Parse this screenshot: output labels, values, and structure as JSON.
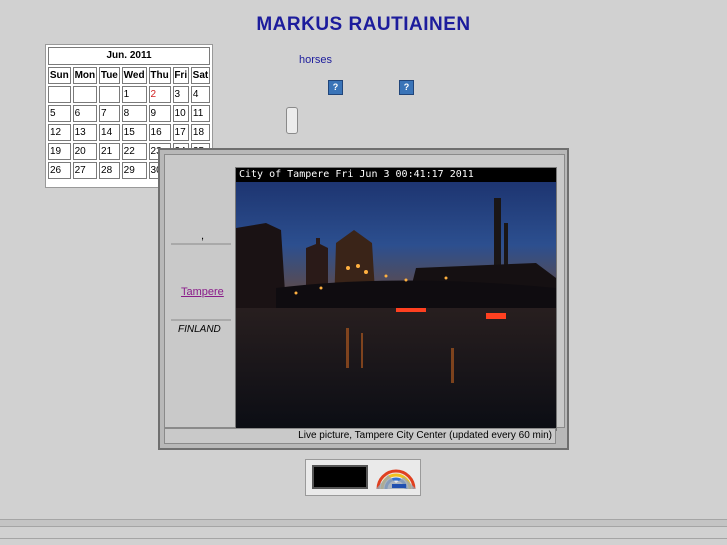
{
  "header": {
    "title": "MARKUS RAUTIAINEN"
  },
  "topic": {
    "link_label": "horses"
  },
  "help_buttons": [
    {
      "label": "?"
    },
    {
      "label": "?"
    }
  ],
  "calendar": {
    "month_label": "Jun. 2011",
    "weekdays": [
      "Sun",
      "Mon",
      "Tue",
      "Wed",
      "Thu",
      "Fri",
      "Sat"
    ],
    "weeks": [
      [
        "",
        "",
        "",
        "1",
        "2",
        "3",
        "4"
      ],
      [
        "5",
        "6",
        "7",
        "8",
        "9",
        "10",
        "11"
      ],
      [
        "12",
        "13",
        "14",
        "15",
        "16",
        "17",
        "18"
      ],
      [
        "19",
        "20",
        "21",
        "22",
        "23",
        "24",
        "25"
      ],
      [
        "26",
        "27",
        "28",
        "29",
        "30",
        "",
        ""
      ]
    ],
    "today": "2"
  },
  "webcam": {
    "side_comma": ",",
    "city_link": "Tampere",
    "country": "FINLAND",
    "caption": "City of Tampere  Fri Jun  3  00:41:17  2011",
    "footer": "Live picture, Tampere City Center (updated every 60 min)"
  },
  "colors": {
    "title": "#1c1c9c",
    "today": "#d02020",
    "link_visited": "#8a1c8a",
    "background": "#d1d1d1"
  }
}
